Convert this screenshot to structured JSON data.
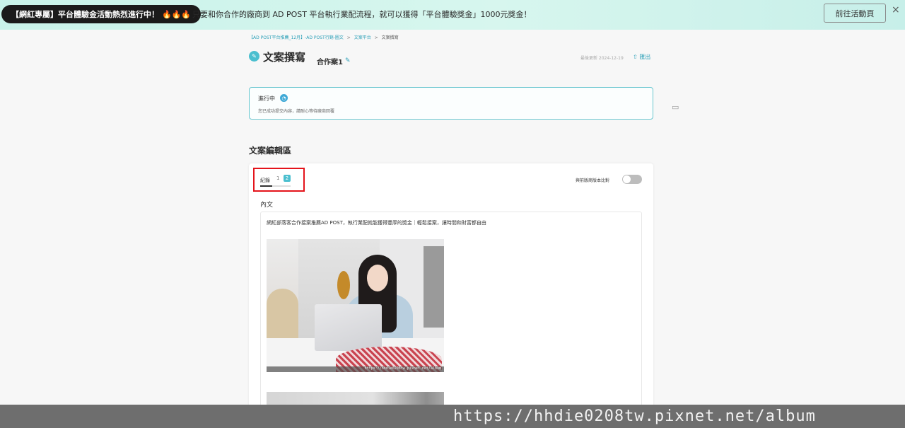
{
  "banner": {
    "badge": "【網紅專屬】平台體驗金活動熱烈進行中！",
    "flames": "🔥🔥🔥",
    "message": "只要和你合作的廠商到 AD POST 平台執行業配流程，就可以獲得「平台體驗獎金」1000元獎金！",
    "button_label": "前往活動頁",
    "close_glyph": "×"
  },
  "breadcrumb": {
    "items": [
      "【AD POST平台推薦_12月】-AD POST行銷-圖文",
      "文案平台",
      "文案撰寫"
    ],
    "separator": ">"
  },
  "header": {
    "icon_glyph": "✎",
    "title": "文案撰寫",
    "case_name": "合作案1",
    "edit_glyph": "✎",
    "updated": "最後更新 2024-12-19",
    "export_glyph": "⇧",
    "export_label": "匯出"
  },
  "status": {
    "label": "進行中",
    "icon_glyph": "◔",
    "message": "您已成功提交內容，請耐心等待廠商回覆"
  },
  "comment_icon_glyph": "▭",
  "editor": {
    "section_title": "文案編輯區",
    "record_label": "紀錄",
    "versions": [
      "1",
      "2"
    ],
    "compare_label": "與前版商版本比對",
    "compare_enabled": false,
    "content_label": "內文",
    "content_text": "網紅部落客合作接案推薦AD POST，執行業配就能獲得豐厚的獎金｜輕鬆接案，讓時間和財富都自由",
    "photo_watermark": "https://hhdie0208tw.pixnet.net/album"
  },
  "watermark": "https://hhdie0208tw.pixnet.net/album",
  "colors": {
    "accent": "#2a9fb7",
    "highlight": "#e4141b",
    "status_border": "#69c6cf"
  }
}
